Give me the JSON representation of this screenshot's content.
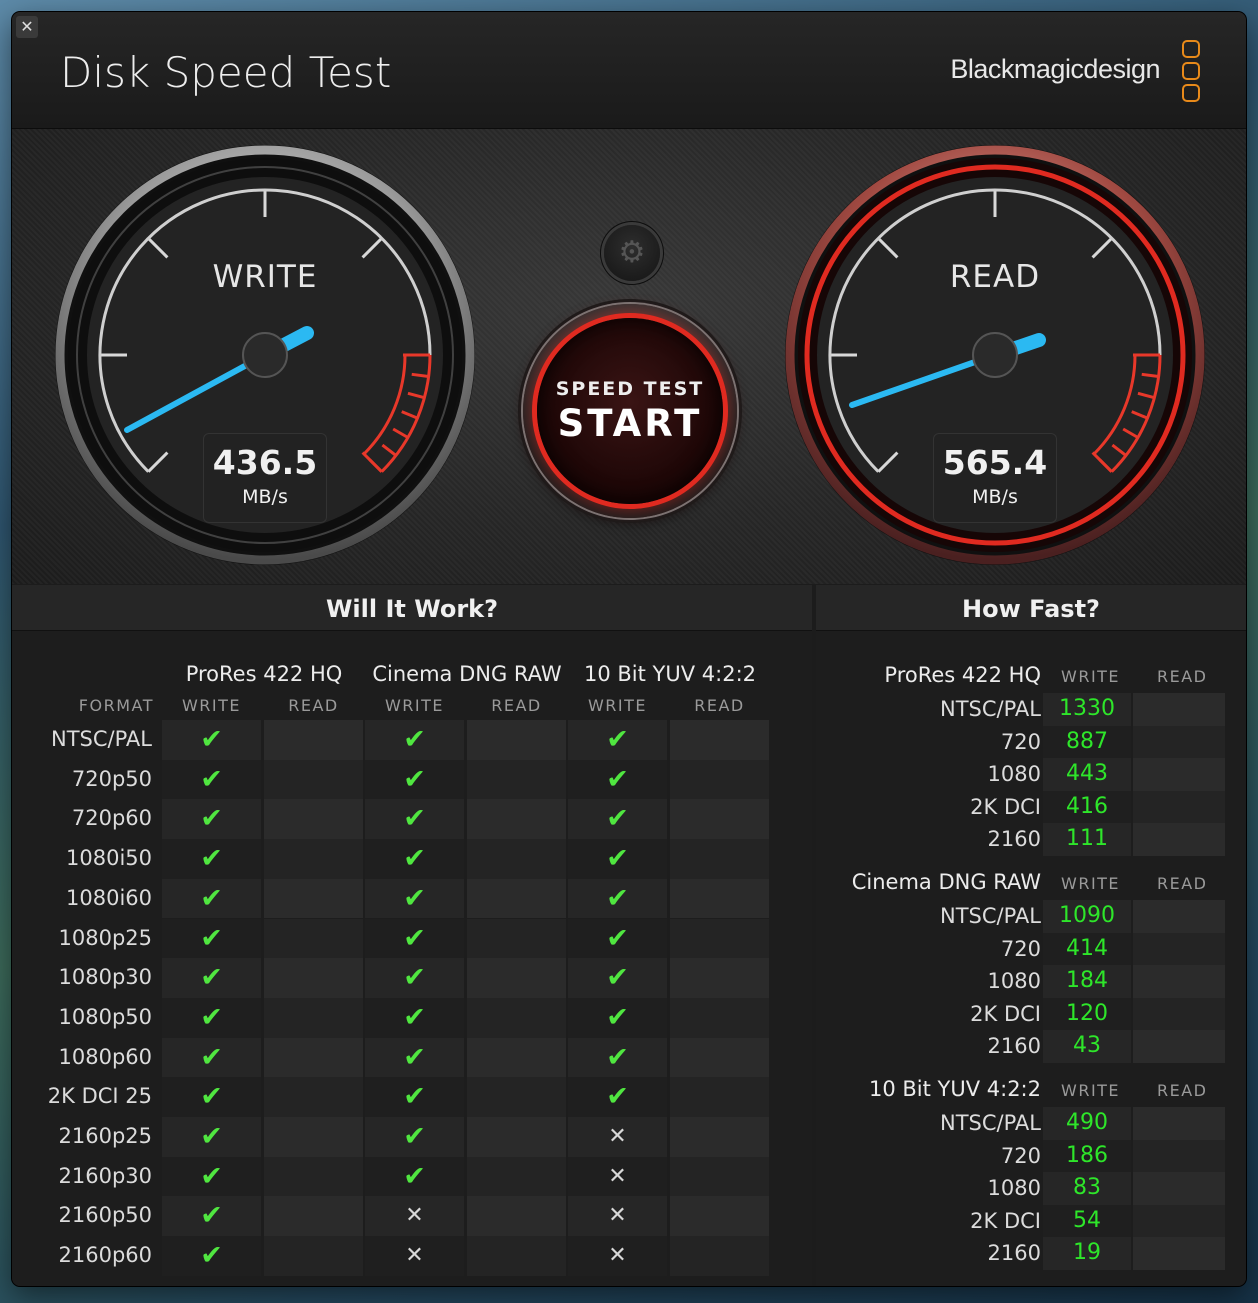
{
  "window": {
    "close_icon": "close-icon",
    "title": "Disk Speed Test",
    "brand": "Blackmagicdesign"
  },
  "gauges": {
    "write": {
      "label": "WRITE",
      "value": "436.5",
      "unit": "MB/s",
      "active_color": "#7a7a7a"
    },
    "read": {
      "label": "READ",
      "value": "565.4",
      "unit": "MB/s",
      "active_color": "#e02a20"
    }
  },
  "controls": {
    "settings_icon": "gear-icon",
    "start_sub": "SPEED TEST",
    "start_main": "START",
    "accent": "#e02a20"
  },
  "will_it_work": {
    "title": "Will It Work?",
    "format_header": "FORMAT",
    "groups": [
      {
        "name": "ProRes 422 HQ",
        "write": "WRITE",
        "read": "READ"
      },
      {
        "name": "Cinema DNG RAW",
        "write": "WRITE",
        "read": "READ"
      },
      {
        "name": "10 Bit YUV 4:2:2",
        "write": "WRITE",
        "read": "READ"
      }
    ],
    "rows": [
      {
        "format": "NTSC/PAL",
        "results": [
          "check",
          "",
          "check",
          "",
          "check",
          ""
        ]
      },
      {
        "format": "720p50",
        "results": [
          "check",
          "",
          "check",
          "",
          "check",
          ""
        ]
      },
      {
        "format": "720p60",
        "results": [
          "check",
          "",
          "check",
          "",
          "check",
          ""
        ]
      },
      {
        "format": "1080i50",
        "results": [
          "check",
          "",
          "check",
          "",
          "check",
          ""
        ]
      },
      {
        "format": "1080i60",
        "results": [
          "check",
          "",
          "check",
          "",
          "check",
          ""
        ]
      },
      {
        "format": "1080p25",
        "results": [
          "check",
          "",
          "check",
          "",
          "check",
          ""
        ]
      },
      {
        "format": "1080p30",
        "results": [
          "check",
          "",
          "check",
          "",
          "check",
          ""
        ]
      },
      {
        "format": "1080p50",
        "results": [
          "check",
          "",
          "check",
          "",
          "check",
          ""
        ]
      },
      {
        "format": "1080p60",
        "results": [
          "check",
          "",
          "check",
          "",
          "check",
          ""
        ]
      },
      {
        "format": "2K DCI 25",
        "results": [
          "check",
          "",
          "check",
          "",
          "check",
          ""
        ]
      },
      {
        "format": "2160p25",
        "results": [
          "check",
          "",
          "check",
          "",
          "cross",
          ""
        ]
      },
      {
        "format": "2160p30",
        "results": [
          "check",
          "",
          "check",
          "",
          "cross",
          ""
        ]
      },
      {
        "format": "2160p50",
        "results": [
          "check",
          "",
          "cross",
          "",
          "cross",
          ""
        ]
      },
      {
        "format": "2160p60",
        "results": [
          "check",
          "",
          "cross",
          "",
          "cross",
          ""
        ]
      }
    ],
    "check_color": "#50e640"
  },
  "how_fast": {
    "title": "How Fast?",
    "value_color": "#2ee62a",
    "sections": [
      {
        "name": "ProRes 422 HQ",
        "write": "WRITE",
        "read": "READ",
        "rows": [
          {
            "label": "NTSC/PAL",
            "write": "1330",
            "read": ""
          },
          {
            "label": "720",
            "write": "887",
            "read": ""
          },
          {
            "label": "1080",
            "write": "443",
            "read": ""
          },
          {
            "label": "2K DCI",
            "write": "416",
            "read": ""
          },
          {
            "label": "2160",
            "write": "111",
            "read": ""
          }
        ]
      },
      {
        "name": "Cinema DNG RAW",
        "write": "WRITE",
        "read": "READ",
        "rows": [
          {
            "label": "NTSC/PAL",
            "write": "1090",
            "read": ""
          },
          {
            "label": "720",
            "write": "414",
            "read": ""
          },
          {
            "label": "1080",
            "write": "184",
            "read": ""
          },
          {
            "label": "2K DCI",
            "write": "120",
            "read": ""
          },
          {
            "label": "2160",
            "write": "43",
            "read": ""
          }
        ]
      },
      {
        "name": "10 Bit YUV 4:2:2",
        "write": "WRITE",
        "read": "READ",
        "rows": [
          {
            "label": "NTSC/PAL",
            "write": "490",
            "read": ""
          },
          {
            "label": "720",
            "write": "186",
            "read": ""
          },
          {
            "label": "1080",
            "write": "83",
            "read": ""
          },
          {
            "label": "2K DCI",
            "write": "54",
            "read": ""
          },
          {
            "label": "2160",
            "write": "19",
            "read": ""
          }
        ]
      }
    ]
  }
}
